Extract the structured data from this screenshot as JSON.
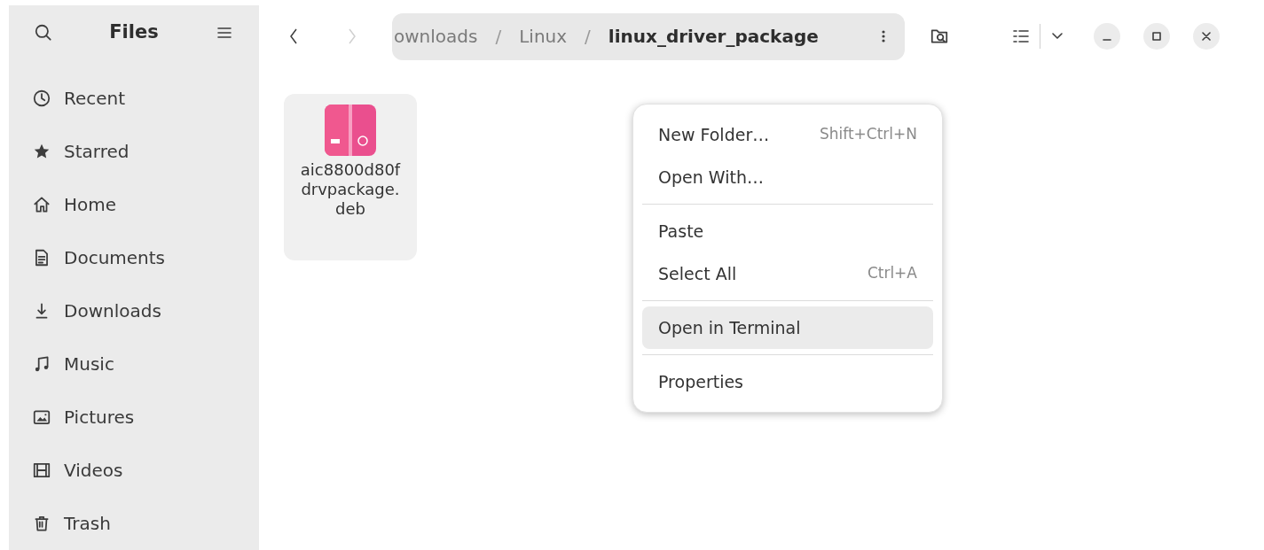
{
  "sidebar": {
    "title": "Files",
    "items": [
      {
        "kind": "recent",
        "label": "Recent"
      },
      {
        "kind": "starred",
        "label": "Starred"
      },
      {
        "kind": "home",
        "label": "Home"
      },
      {
        "kind": "documents",
        "label": "Documents"
      },
      {
        "kind": "downloads",
        "label": "Downloads"
      },
      {
        "kind": "music",
        "label": "Music"
      },
      {
        "kind": "pictures",
        "label": "Pictures"
      },
      {
        "kind": "videos",
        "label": "Videos"
      },
      {
        "kind": "trash",
        "label": "Trash"
      }
    ]
  },
  "toolbar": {
    "back_disabled": false,
    "forward_disabled": true,
    "path": [
      {
        "label": "ownloads",
        "current": false
      },
      {
        "label": "Linux",
        "current": false
      },
      {
        "label": "linux_driver_package",
        "current": true
      }
    ],
    "separator": "/"
  },
  "files": [
    {
      "name": "aic8800d80f\ndrvpackage.\ndeb",
      "kind": "deb"
    }
  ],
  "context_menu": {
    "sections": [
      [
        {
          "label": "New Folder…",
          "shortcut": "Shift+Ctrl+N",
          "selected": false
        },
        {
          "label": "Open With…",
          "selected": false
        }
      ],
      [
        {
          "label": "Paste",
          "selected": false
        },
        {
          "label": "Select All",
          "shortcut": "Ctrl+A",
          "selected": false
        }
      ],
      [
        {
          "label": "Open in Terminal",
          "selected": true
        }
      ],
      [
        {
          "label": "Properties",
          "selected": false
        }
      ]
    ]
  }
}
